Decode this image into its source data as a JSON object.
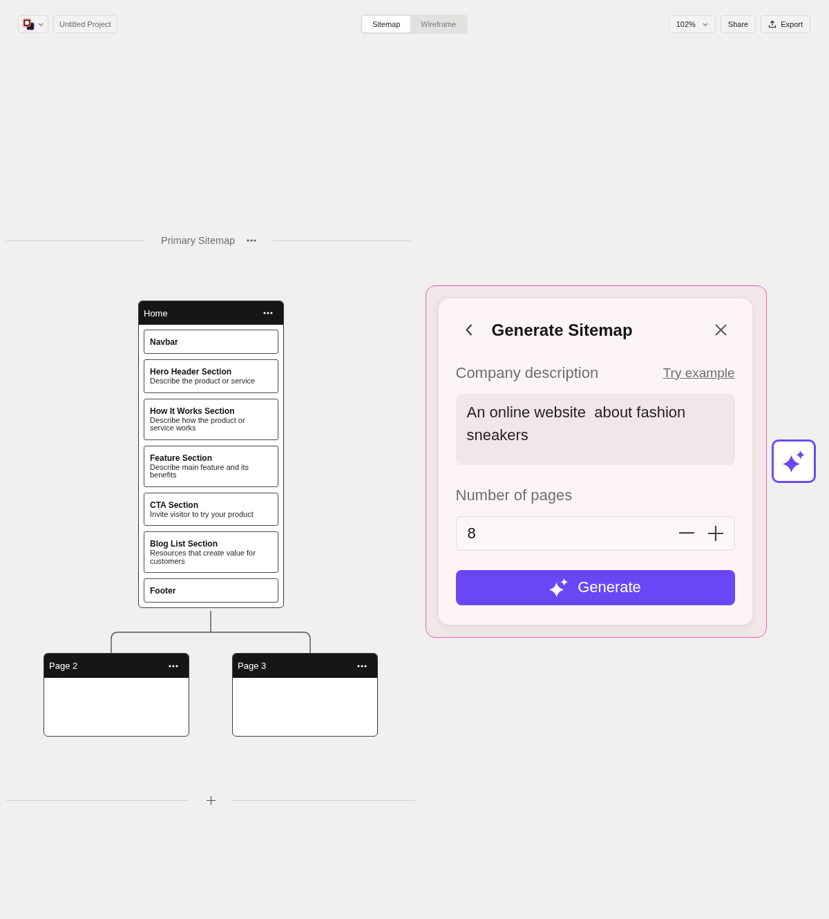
{
  "toolbar": {
    "project_name": "Untitled Project",
    "view_tabs": [
      {
        "label": "Sitemap",
        "selected": true
      },
      {
        "label": "Wireframe",
        "selected": false
      }
    ],
    "zoom": "102%",
    "share": "Share",
    "export": "Export"
  },
  "sitemap": {
    "title": "Primary Sitemap",
    "home": {
      "title": "Home",
      "sections": [
        {
          "title": "Navbar"
        },
        {
          "title": "Hero Header Section",
          "description": "Describe the product or service"
        },
        {
          "title": "How It Works Section",
          "description": "Describe how the product or service works"
        },
        {
          "title": "Feature Section",
          "description": "Describe main feature and its benefits"
        },
        {
          "title": "CTA Section",
          "description": "Invite visitor to try your product"
        },
        {
          "title": "Blog List Section",
          "description": "Resources that create value for customers"
        },
        {
          "title": "Footer"
        }
      ]
    },
    "pages": [
      {
        "title": "Page 2"
      },
      {
        "title": "Page 3"
      }
    ]
  },
  "dialog": {
    "title": "Generate Sitemap",
    "description_label": "Company description",
    "try_example": "Try example",
    "description_value": "An online website  about fashion sneakers",
    "pages_label": "Number of pages",
    "pages_value": "8",
    "generate": "Generate"
  }
}
